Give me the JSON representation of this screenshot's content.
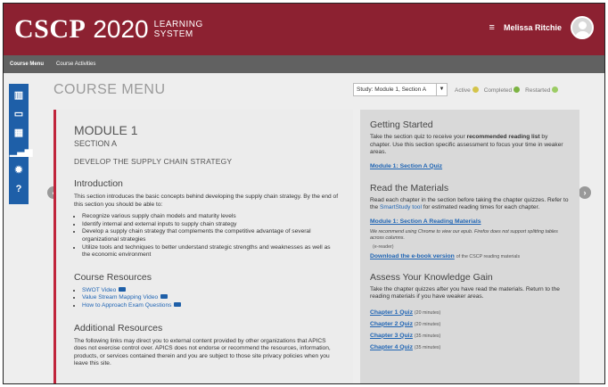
{
  "header": {
    "brand": "CSCP",
    "year": "2020",
    "system_line1": "LEARNING",
    "system_line2": "SYSTEM",
    "menu_glyph": "≡",
    "user_name": "Melissa Ritchie"
  },
  "subnav": {
    "course_menu": "Course Menu",
    "course_activities": "Course Activities"
  },
  "page": {
    "title": "COURSE MENU",
    "study_select": "Study: Module 1, Section A",
    "legend_active": "Active",
    "legend_completed": "Completed",
    "legend_restarted": "Restarted",
    "active_color": "#d4c44a",
    "completed_color": "#7cb342",
    "restarted_color": "#9ccc65"
  },
  "sidebar": {
    "icons": [
      "books-icon",
      "monitor-icon",
      "grid-icon",
      "chart-icon",
      "gear-icon",
      "help-icon"
    ]
  },
  "module": {
    "heading": "MODULE 1",
    "section": "SECTION A",
    "strategy": "DEVELOP THE SUPPLY CHAIN STRATEGY",
    "intro_heading": "Introduction",
    "intro_text": "This section introduces the basic concepts behind developing the supply chain strategy. By the end of this section you should be able to:",
    "bullets": [
      "Recognize various supply chain models and maturity levels",
      "Identify internal and external inputs to supply chain strategy",
      "Develop a supply chain strategy that complements the competitive advantage of several organizational strategies",
      "Utilize tools and techniques to better understand strategic strengths and weaknesses as well as the economic environment"
    ],
    "resources_heading": "Course Resources",
    "resources": [
      "SWOT Video",
      "Value Stream Mapping Video",
      "How to Approach Exam Questions"
    ],
    "additional_heading": "Additional Resources",
    "additional_text": "The following links may direct you to external content provided by other organizations that APICS does not exercise control over. APICS does not endorse or recommend the resources, information, products, or services contained therein and you are subject to those site privacy policies when you leave this site."
  },
  "right": {
    "getting_started_heading": "Getting Started",
    "gs_text_1": "Take the section quiz to receive your ",
    "gs_text_bold": "recommended reading list",
    "gs_text_2": " by chapter. Use this section specific assessment to focus your time in weaker areas.",
    "gs_link": "Module 1: Section A Quiz",
    "read_heading": "Read the Materials",
    "read_text_1": "Read each chapter in the section before taking the chapter quizzes. Refer to the ",
    "read_link_inline": "SmartStudy tool",
    "read_text_2": " for estimated reading times for each chapter.",
    "read_link": "Module 1: Section A Reading Materials",
    "read_note": "We recommend using Chrome to view our epub. Firefox does not support splitting tables across columns.",
    "ereader": "(e-reader)",
    "ebook_link": "Download the e-book version",
    "ebook_note": "of the CSCP reading materials",
    "assess_heading": "Assess Your Knowledge Gain",
    "assess_text": "Take the chapter quizzes after you have read the materials. Return to the reading materials if you have weaker areas.",
    "quizzes": [
      {
        "label": "Chapter 1 Quiz",
        "time": "(20 minutes)"
      },
      {
        "label": "Chapter 2 Quiz",
        "time": "(20 minutes)"
      },
      {
        "label": "Chapter 3 Quiz",
        "time": "(35 minutes)"
      },
      {
        "label": "Chapter 4 Quiz",
        "time": "(35 minutes)"
      }
    ]
  }
}
